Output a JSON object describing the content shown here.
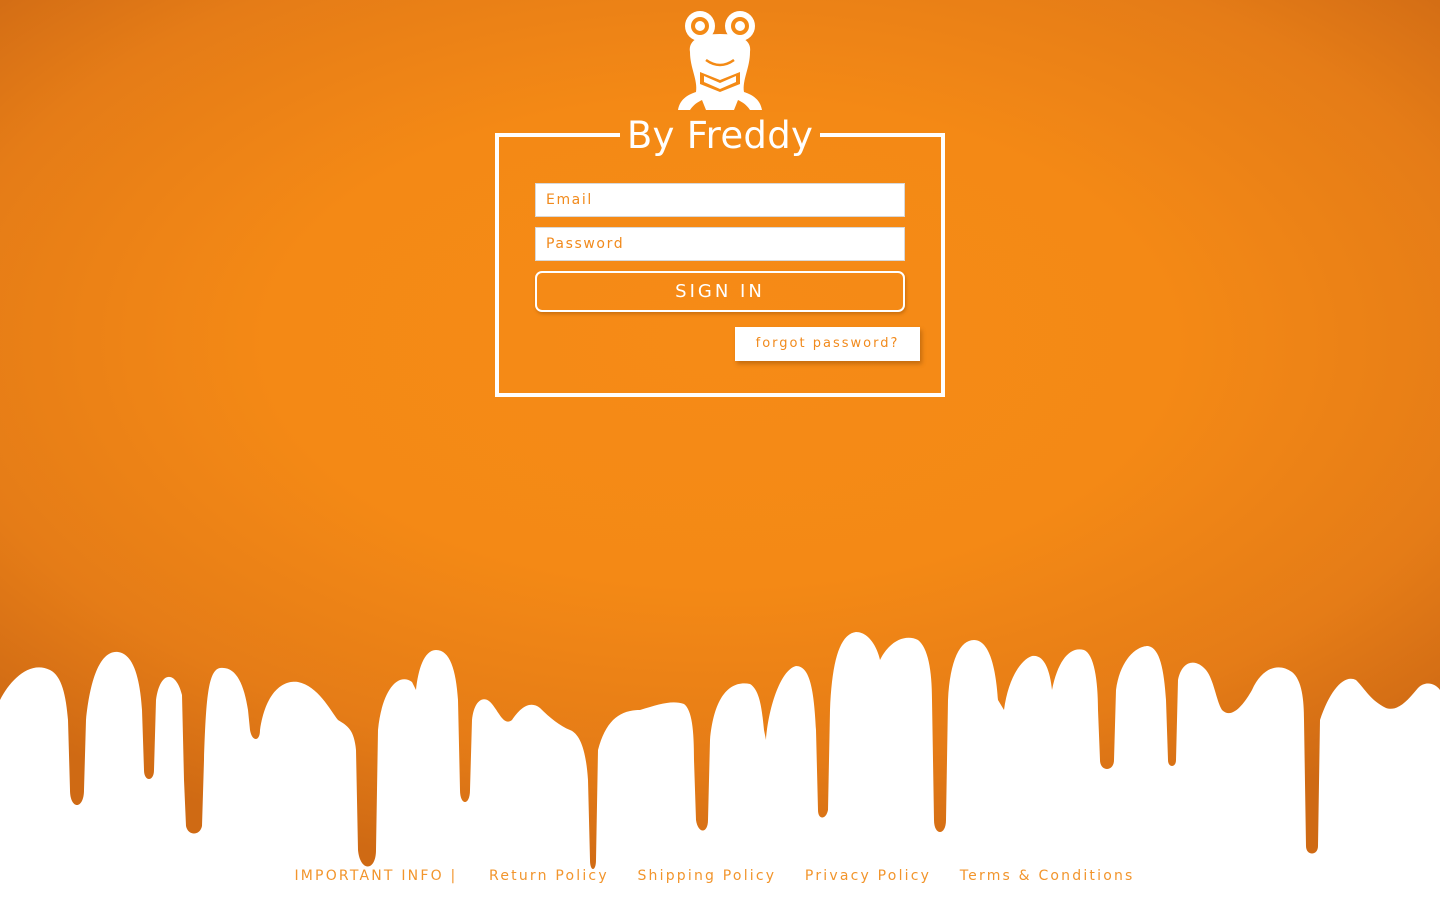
{
  "brand": {
    "title": "By Freddy",
    "logo_icon": "frog-icon"
  },
  "login": {
    "email_placeholder": "Email",
    "password_placeholder": "Password",
    "signin_label": "SIGN IN",
    "forgot_label": "forgot password?"
  },
  "footer": {
    "important_label": "IMPORTANT INFO |",
    "links": [
      "Return Policy",
      "Shipping Policy",
      "Privacy Policy",
      "Terms & Conditions"
    ]
  },
  "colors": {
    "background": "#f48a15",
    "accent_text": "#f18a1c",
    "white": "#ffffff"
  }
}
